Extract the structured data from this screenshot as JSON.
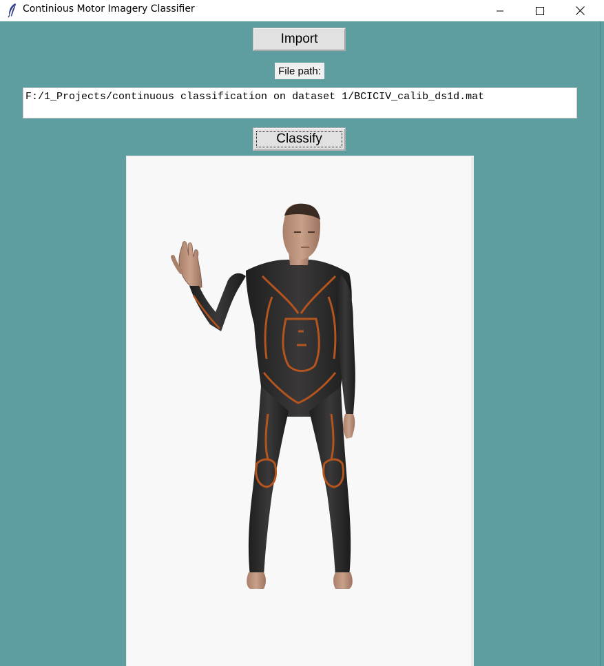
{
  "window": {
    "title": "Continious Motor Imagery Classifier",
    "icon": "feather-icon",
    "controls": [
      "minimize-icon",
      "maximize-icon",
      "close-icon"
    ]
  },
  "buttons": {
    "import_label": "Import",
    "classify_label": "Classify"
  },
  "file_path": {
    "label": "File path:",
    "value": "F:/1_Projects/continuous classification on dataset 1/BCICIV_calib_ds1d.mat"
  },
  "display": {
    "content": "3d-avatar-waving-left-hand",
    "background_color": "#5f9ea0"
  }
}
